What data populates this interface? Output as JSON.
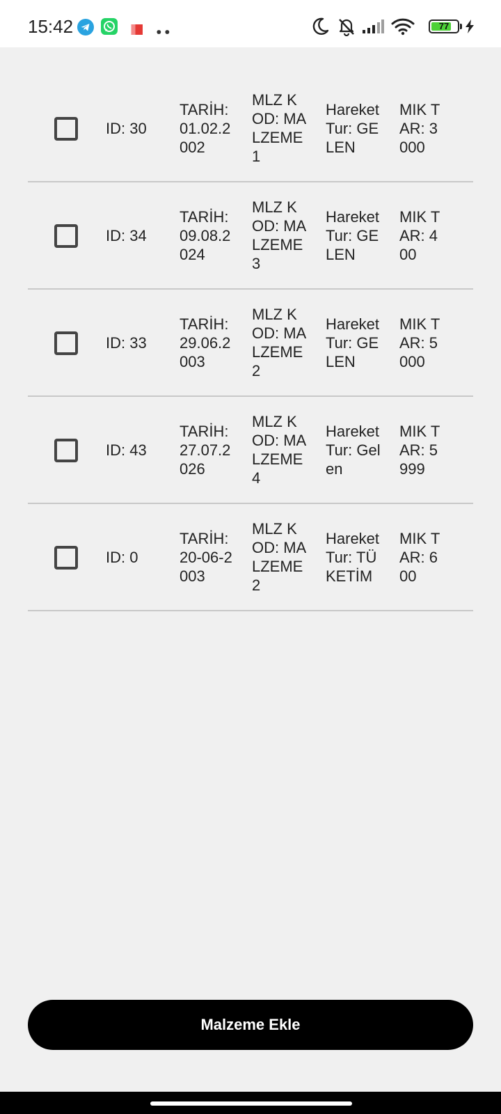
{
  "status_bar": {
    "time": "15:42",
    "battery_level": "77",
    "battery_fraction": 0.77,
    "left_icons": [
      "telegram-icon",
      "whatsapp-icon",
      "notification-flag-icon",
      "more-dots-icon"
    ],
    "right_icons": [
      "moon-icon",
      "bell-off-icon",
      "signal-icon",
      "wifi-icon",
      "battery-icon",
      "charging-bolt-icon"
    ],
    "colors": {
      "telegram": "#2aa3e0",
      "whatsapp": "#25d366",
      "flag": "#e53935",
      "battery_fill": "#4cd137"
    }
  },
  "items": [
    {
      "id": "ID: 30",
      "date": "TARİH: 01.02.2002",
      "code": "MLZ KOD: MALZEME1",
      "type": "Hareket Tur: GELEN",
      "qty": "MIK TAR: 3000"
    },
    {
      "id": "ID: 34",
      "date": "TARİH: 09.08.2024",
      "code": "MLZ KOD: MALZEME3",
      "type": "Hareket Tur: GELEN",
      "qty": "MIK TAR: 400"
    },
    {
      "id": "ID: 33",
      "date": "TARİH: 29.06.2003",
      "code": "MLZ KOD: MALZEME2",
      "type": "Hareket Tur: GELEN",
      "qty": "MIK TAR: 5000"
    },
    {
      "id": "ID: 43",
      "date": "TARİH: 27.07.2026",
      "code": "MLZ KOD: MALZEME4",
      "type": "Hareket Tur: Gelen",
      "qty": "MIK TAR: 5999"
    },
    {
      "id": "ID: 0",
      "date": "TARİH: 20-06-2003",
      "code": "MLZ KOD: MALZEME2",
      "type": "Hareket Tur: TÜKETİM",
      "qty": "MIK TAR: 600"
    }
  ],
  "add_button": {
    "label": "Malzeme Ekle",
    "color": "#000000"
  }
}
